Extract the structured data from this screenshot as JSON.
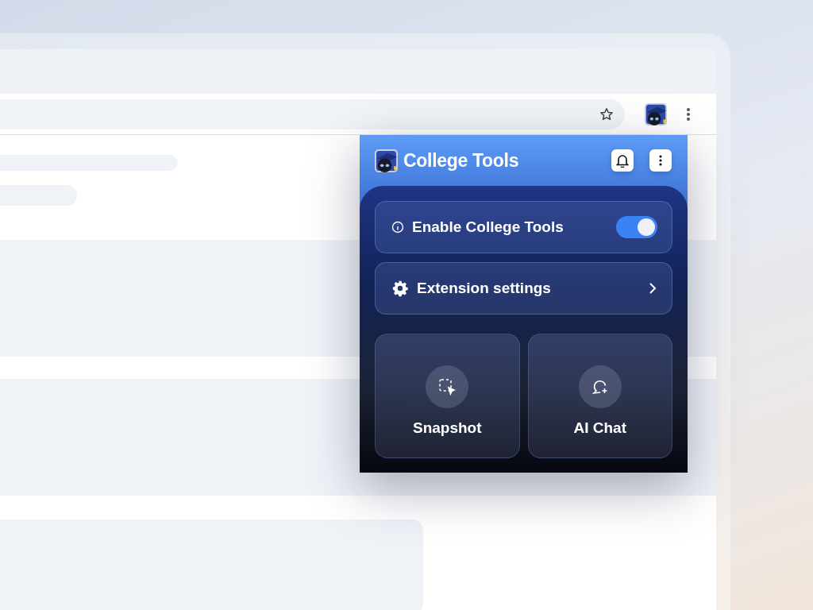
{
  "popup": {
    "title": "College Tools",
    "toggle_row": {
      "label": "Enable College Tools",
      "on": true
    },
    "settings_row": {
      "label": "Extension settings"
    },
    "tiles": [
      {
        "kind": "snapshot",
        "label": "Snapshot"
      },
      {
        "kind": "chat",
        "label": "AI Chat"
      }
    ]
  }
}
